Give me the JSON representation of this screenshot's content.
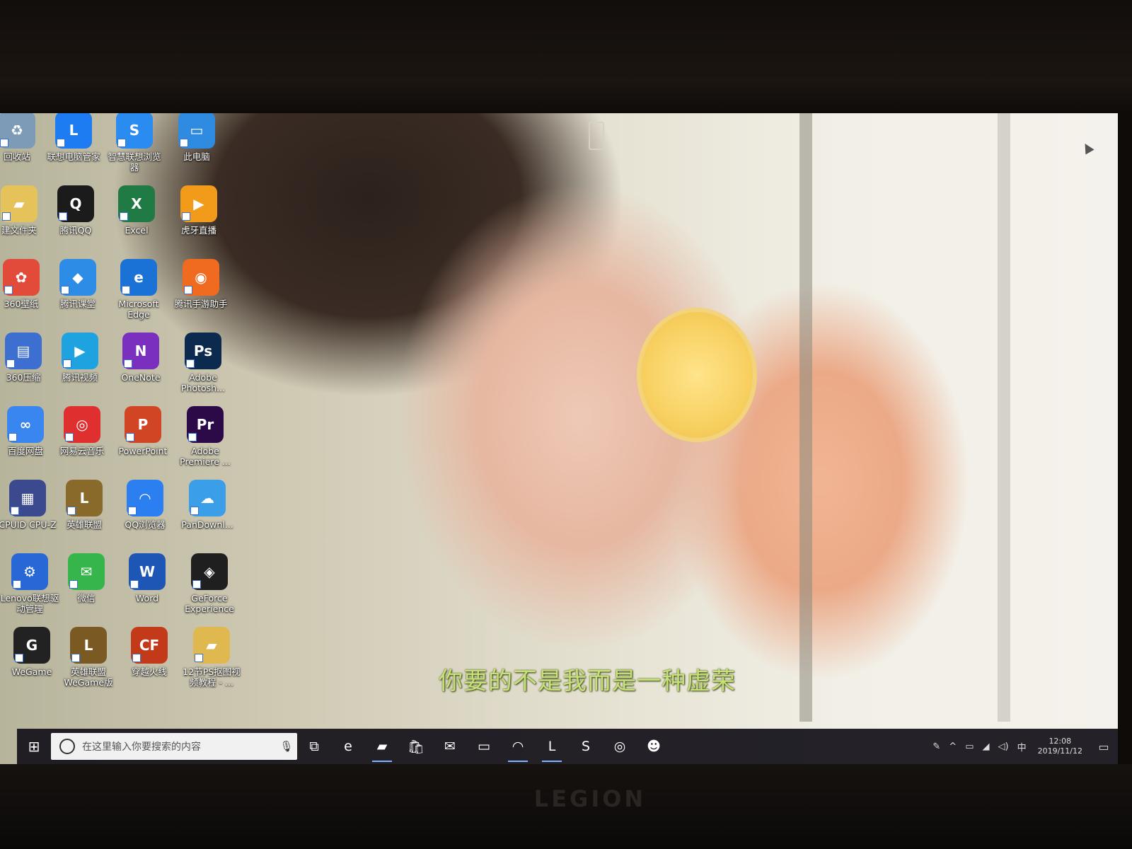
{
  "desktop": {
    "icons": [
      {
        "label": "回收站",
        "glyph": "♻",
        "color": "#7d9ab6"
      },
      {
        "label": "联想电脑管家",
        "glyph": "L",
        "color": "#1e7cf2"
      },
      {
        "label": "智慧联想浏览器",
        "glyph": "S",
        "color": "#2a8cf0"
      },
      {
        "label": "此电脑",
        "glyph": "▭",
        "color": "#2f8be0"
      },
      {
        "label": "建文件夹",
        "glyph": "▰",
        "color": "#e6c25a"
      },
      {
        "label": "腾讯QQ",
        "glyph": "Q",
        "color": "#1b1b1b"
      },
      {
        "label": "Excel",
        "glyph": "X",
        "color": "#1f7a43"
      },
      {
        "label": "虎牙直播",
        "glyph": "▶",
        "color": "#f29a1a"
      },
      {
        "label": "360壁纸",
        "glyph": "✿",
        "color": "#e24b3a"
      },
      {
        "label": "腾讯课堂",
        "glyph": "◆",
        "color": "#2d8de6"
      },
      {
        "label": "Microsoft Edge",
        "glyph": "e",
        "color": "#1a72d6"
      },
      {
        "label": "腾讯手游助手",
        "glyph": "◉",
        "color": "#f06b1f"
      },
      {
        "label": "360压缩",
        "glyph": "▤",
        "color": "#3c6fd0"
      },
      {
        "label": "腾讯视频",
        "glyph": "▶",
        "color": "#1ea3e0"
      },
      {
        "label": "OneNote",
        "glyph": "N",
        "color": "#7b2fbf"
      },
      {
        "label": "Adobe Photosh...",
        "glyph": "Ps",
        "color": "#0c2a4d"
      },
      {
        "label": "百度网盘",
        "glyph": "∞",
        "color": "#3a86f0"
      },
      {
        "label": "网易云音乐",
        "glyph": "◎",
        "color": "#e02f2f"
      },
      {
        "label": "PowerPoint",
        "glyph": "P",
        "color": "#d14524"
      },
      {
        "label": "Adobe Premiere ...",
        "glyph": "Pr",
        "color": "#2b0a47"
      },
      {
        "label": "CPUID CPU-Z",
        "glyph": "▦",
        "color": "#3b4a8f"
      },
      {
        "label": "英雄联盟",
        "glyph": "L",
        "color": "#8a6a2a"
      },
      {
        "label": "QQ浏览器",
        "glyph": "◠",
        "color": "#2b7ff0"
      },
      {
        "label": "PanDownl...",
        "glyph": "☁",
        "color": "#3a9ee8"
      },
      {
        "label": "Lenovo联想驱动管理",
        "glyph": "⚙",
        "color": "#2767d6"
      },
      {
        "label": "微信",
        "glyph": "✉",
        "color": "#36b64a"
      },
      {
        "label": "Word",
        "glyph": "W",
        "color": "#1e56b6"
      },
      {
        "label": "GeForce Experience",
        "glyph": "◈",
        "color": "#1f1f1f"
      },
      {
        "label": "WeGame",
        "glyph": "G",
        "color": "#222222"
      },
      {
        "label": "英雄联盟WeGame版",
        "glyph": "L",
        "color": "#7a5a22"
      },
      {
        "label": "穿越火线",
        "glyph": "CF",
        "color": "#c23a1a"
      },
      {
        "label": "12节PS抠图视频教程 - ...",
        "glyph": "▰",
        "color": "#e0b850"
      }
    ],
    "subtitle": "你要的不是我而是一种虚荣"
  },
  "taskbar": {
    "start_glyph": "⊞",
    "search_placeholder": "在这里输入你要搜索的内容",
    "mic_glyph": "🎙",
    "pinned": [
      {
        "name": "task-view",
        "glyph": "⧉",
        "active": false
      },
      {
        "name": "edge",
        "glyph": "e",
        "active": false
      },
      {
        "name": "file-explorer",
        "glyph": "▰",
        "active": true
      },
      {
        "name": "store",
        "glyph": "🛍",
        "active": false
      },
      {
        "name": "mail",
        "glyph": "✉",
        "active": false
      },
      {
        "name": "this-pc",
        "glyph": "▭",
        "active": false
      },
      {
        "name": "qq-browser",
        "glyph": "◠",
        "active": true
      },
      {
        "name": "lenovo-pc-manager",
        "glyph": "L",
        "active": true
      },
      {
        "name": "lenovo-browser",
        "glyph": "S",
        "active": false
      },
      {
        "name": "netease-music",
        "glyph": "◎",
        "active": false
      },
      {
        "name": "qq",
        "glyph": "☻",
        "active": false
      }
    ],
    "tray": {
      "pen_glyph": "✎",
      "chevron": "^",
      "battery": "▭",
      "network": "◢",
      "volume": "◁)",
      "ime": "中",
      "time": "12:08",
      "date": "2019/11/12",
      "notify_glyph": "▭"
    }
  },
  "monitor": {
    "brand": "LEGION"
  }
}
